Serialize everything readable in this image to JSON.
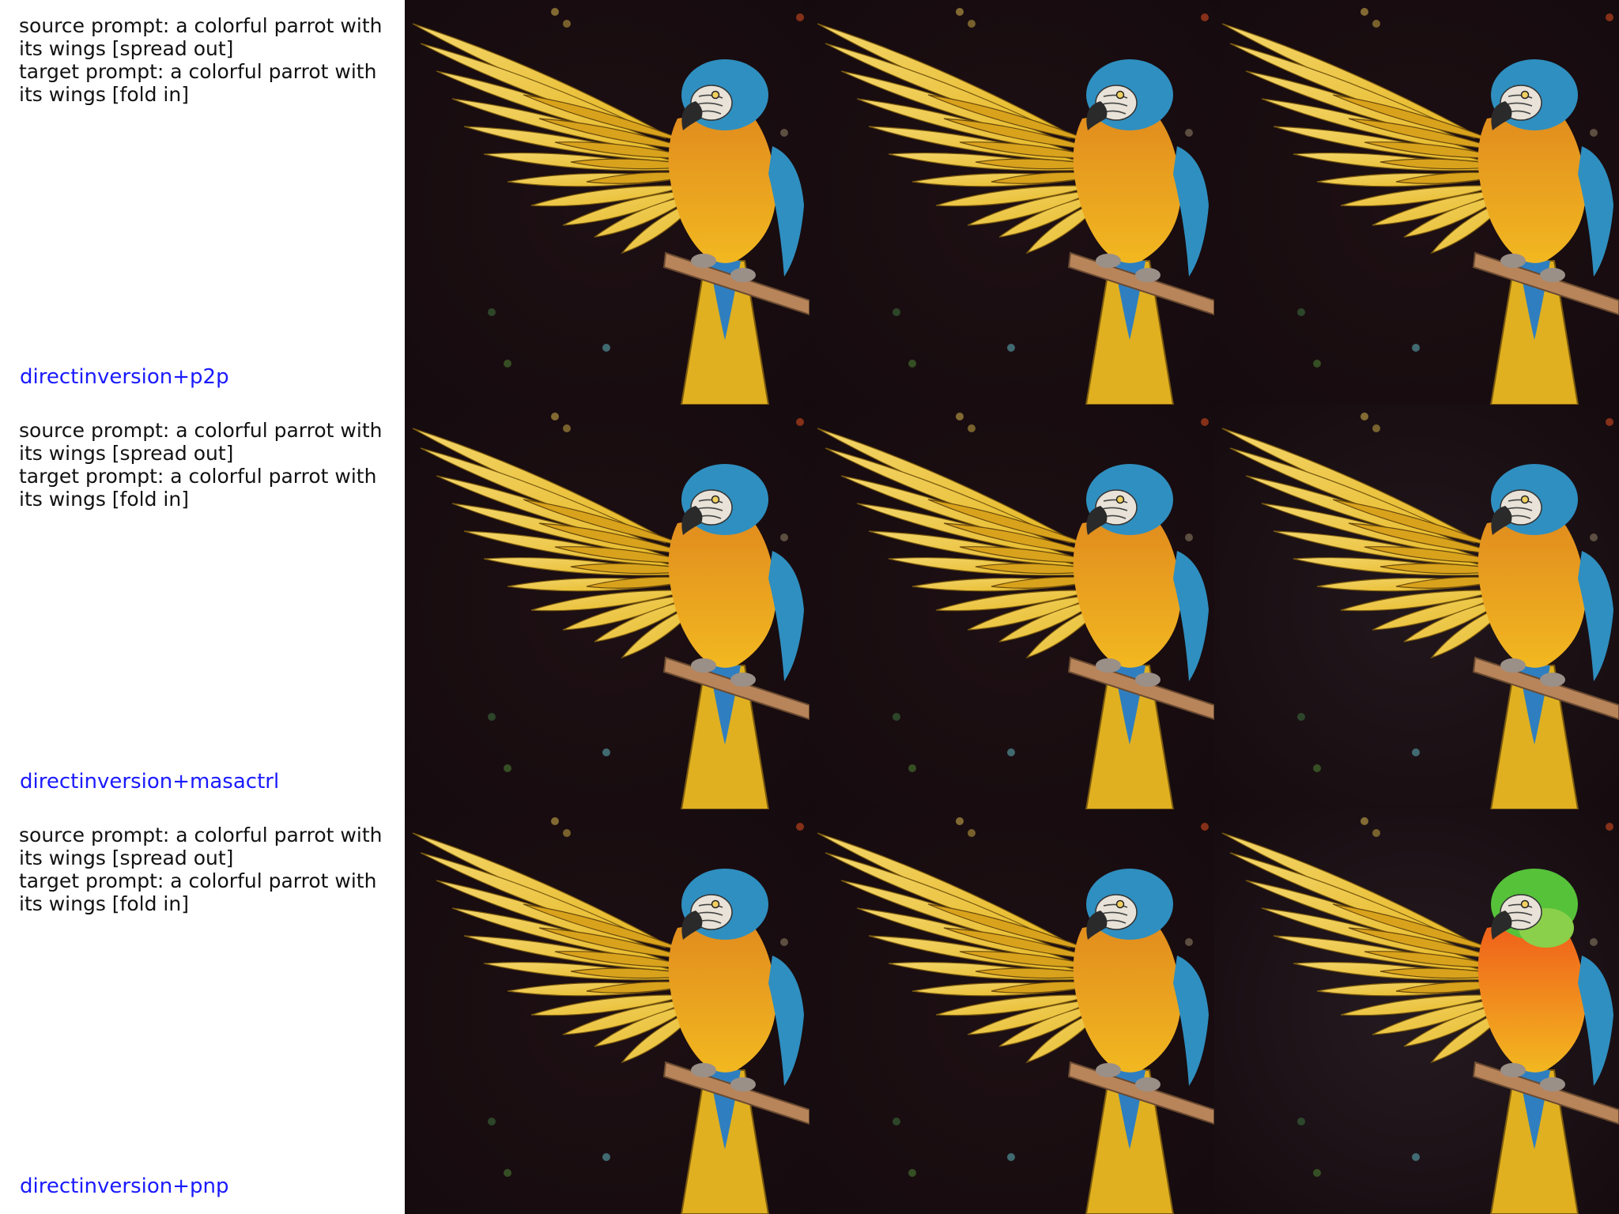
{
  "rows": [
    {
      "prompt": "source prompt: a colorful parrot with\nits wings [spread out]\ntarget prompt: a colorful parrot with\nits wings [fold in]",
      "method": "directinversion+p2p",
      "images": [
        {
          "subject": "parrot-spread-wings",
          "variant": "source",
          "background": "#1e1014"
        },
        {
          "subject": "parrot-spread-wings",
          "variant": "edited",
          "background": "#1e1014"
        },
        {
          "subject": "parrot-spread-wings",
          "variant": "edited",
          "background": "#1e1014"
        }
      ]
    },
    {
      "prompt": "source prompt: a colorful parrot with\nits wings [spread out]\ntarget prompt: a colorful parrot with\nits wings [fold in]",
      "method": "directinversion+masactrl",
      "images": [
        {
          "subject": "parrot-spread-wings",
          "variant": "source",
          "background": "#1e1014"
        },
        {
          "subject": "parrot-spread-wings",
          "variant": "edited",
          "background": "#1e1014"
        },
        {
          "subject": "parrot-spread-wings",
          "variant": "edited",
          "background": "#22171c"
        }
      ]
    },
    {
      "prompt": "source prompt: a colorful parrot with\nits wings [spread out]\ntarget prompt: a colorful parrot with\nits wings [fold in]",
      "method": "directinversion+pnp",
      "images": [
        {
          "subject": "parrot-spread-wings",
          "variant": "source",
          "background": "#1e1014"
        },
        {
          "subject": "parrot-spread-wings",
          "variant": "edited",
          "background": "#1e1014"
        },
        {
          "subject": "parrot-spread-wings-green-head",
          "variant": "edited",
          "background": "#241a20"
        }
      ]
    }
  ],
  "colors": {
    "method_label": "#1a1aff",
    "prompt_text": "#111111",
    "wing_yellow": "#e6b825",
    "wing_light": "#f3d56a",
    "body_orange": "#e08a1e",
    "head_blue": "#2f8fc0",
    "head_green": "#56c23a",
    "perch": "#b8845a"
  }
}
